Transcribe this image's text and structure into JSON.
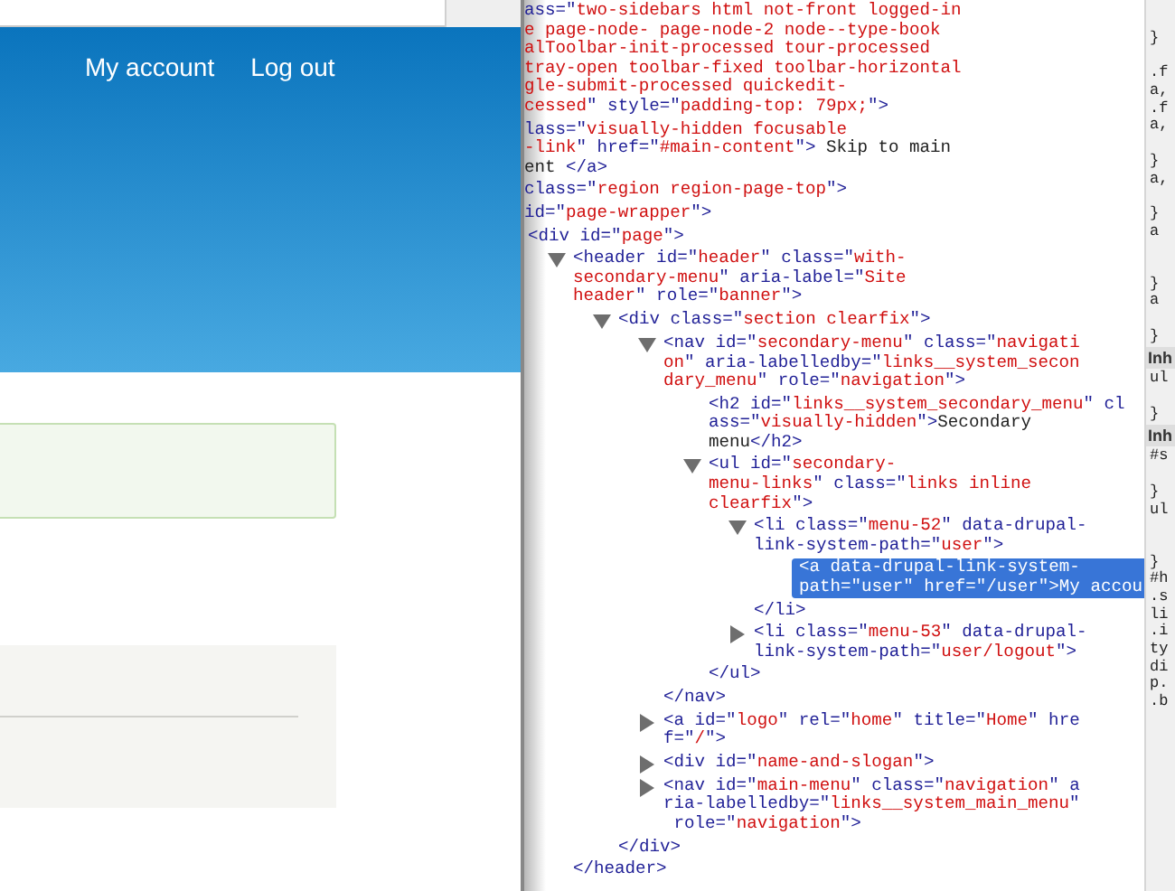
{
  "page_preview": {
    "header_links": [
      {
        "label": "My account"
      },
      {
        "label": "Log out"
      }
    ]
  },
  "inspector": {
    "clipped_nodes": [
      {
        "lines": [
          "ass=\"two-sidebars html not-front logged-in",
          "e page-node- page-node-2 node--type-book",
          "alToolbar-init-processed tour-processed",
          "tray-open toolbar-fixed toolbar-horizontal",
          "gle-submit-processed quickedit-",
          "cessed\" style=\"padding-top: 79px;\">"
        ]
      },
      {
        "lines": [
          "lass=\"visually-hidden focusable",
          "-link\" href=\"#main-content\"> Skip to main",
          "ent </a>"
        ]
      },
      {
        "lines": [
          "class=\"region region-page-top\">"
        ]
      },
      {
        "lines": [
          "id=\"page-wrapper\">"
        ]
      }
    ],
    "tree": [
      {
        "lines": [
          "<div id=\"page\">"
        ],
        "selected": false,
        "children": [
          {
            "lines": [
              "<header id=\"header\" class=\"with-",
              "secondary-menu\" aria-label=\"Site",
              "header\" role=\"banner\">"
            ],
            "expanded": true,
            "selected": false,
            "close": "</header>",
            "children": [
              {
                "lines": [
                  "<div class=\"section clearfix\">"
                ],
                "expanded": true,
                "selected": false,
                "close": "</div>",
                "children": [
                  {
                    "lines": [
                      "<nav id=\"secondary-menu\" class=\"navigati",
                      "on\" aria-labelledby=\"links__system_secon",
                      "dary_menu\" role=\"navigation\">"
                    ],
                    "expanded": true,
                    "selected": false,
                    "close": "</nav>",
                    "children": [
                      {
                        "lines": [
                          "<h2 id=\"links__system_secondary_menu\" cl",
                          "ass=\"visually-hidden\">Secondary",
                          "menu</h2>"
                        ],
                        "selected": false
                      },
                      {
                        "lines": [
                          "<ul id=\"secondary-",
                          "menu-links\" class=\"links inline",
                          "clearfix\">"
                        ],
                        "expanded": true,
                        "selected": false,
                        "close": "</ul>",
                        "children": [
                          {
                            "lines": [
                              "<li class=\"menu-52\" data-drupal-",
                              "link-system-path=\"user\">"
                            ],
                            "expanded": true,
                            "selected": false,
                            "close": "</li>",
                            "children": [
                              {
                                "lines": [
                                  "<a data-drupal-link-system-",
                                  "path=\"user\" href=\"/user\">My accou"
                                ],
                                "selected": true
                              }
                            ]
                          },
                          {
                            "lines": [
                              "<li class=\"menu-53\" data-drupal-",
                              "link-system-path=\"user/logout\">"
                            ],
                            "expanded": false,
                            "selected": false
                          }
                        ]
                      }
                    ]
                  },
                  {
                    "lines": [
                      "<a id=\"logo\" rel=\"home\" title=\"Home\" hre",
                      "f=\"/\">"
                    ],
                    "expanded": false,
                    "selected": false
                  },
                  {
                    "lines": [
                      "<div id=\"name-and-slogan\">"
                    ],
                    "expanded": false,
                    "selected": false
                  },
                  {
                    "lines": [
                      "<nav id=\"main-menu\" class=\"navigation\" a",
                      "ria-labelledby=\"links__system_main_menu\"",
                      " role=\"navigation\">"
                    ],
                    "expanded": false,
                    "selected": false
                  }
                ]
              }
            ]
          }
        ]
      }
    ]
  },
  "styles_panel": [
    {
      "kind": "code",
      "text": "}"
    },
    {
      "kind": "blank"
    },
    {
      "kind": "code",
      "text": ".f"
    },
    {
      "kind": "code",
      "text": "a,"
    },
    {
      "kind": "code",
      "text": ".f"
    },
    {
      "kind": "code",
      "text": "a,"
    },
    {
      "kind": "blank"
    },
    {
      "kind": "code",
      "text": "}"
    },
    {
      "kind": "code",
      "text": "a,"
    },
    {
      "kind": "blank"
    },
    {
      "kind": "code",
      "text": "}"
    },
    {
      "kind": "code",
      "text": "a"
    },
    {
      "kind": "blank"
    },
    {
      "kind": "blank"
    },
    {
      "kind": "code",
      "text": "}"
    },
    {
      "kind": "code",
      "text": "a"
    },
    {
      "kind": "blank"
    },
    {
      "kind": "code",
      "text": "}"
    },
    {
      "kind": "section",
      "text": "Inh"
    },
    {
      "kind": "code",
      "text": "ul"
    },
    {
      "kind": "blank"
    },
    {
      "kind": "code",
      "text": "}"
    },
    {
      "kind": "section",
      "text": "Inh"
    },
    {
      "kind": "code",
      "text": "#s"
    },
    {
      "kind": "blank"
    },
    {
      "kind": "code",
      "text": "}"
    },
    {
      "kind": "code",
      "text": "ul"
    },
    {
      "kind": "blank"
    },
    {
      "kind": "blank"
    },
    {
      "kind": "code",
      "text": "}"
    },
    {
      "kind": "code",
      "text": "#h"
    },
    {
      "kind": "code",
      "text": ".s"
    },
    {
      "kind": "code",
      "text": "li"
    },
    {
      "kind": "code",
      "text": ".i"
    },
    {
      "kind": "code",
      "text": "ty"
    },
    {
      "kind": "code",
      "text": "di"
    },
    {
      "kind": "code",
      "text": "p."
    },
    {
      "kind": "code",
      "text": ".b"
    }
  ]
}
